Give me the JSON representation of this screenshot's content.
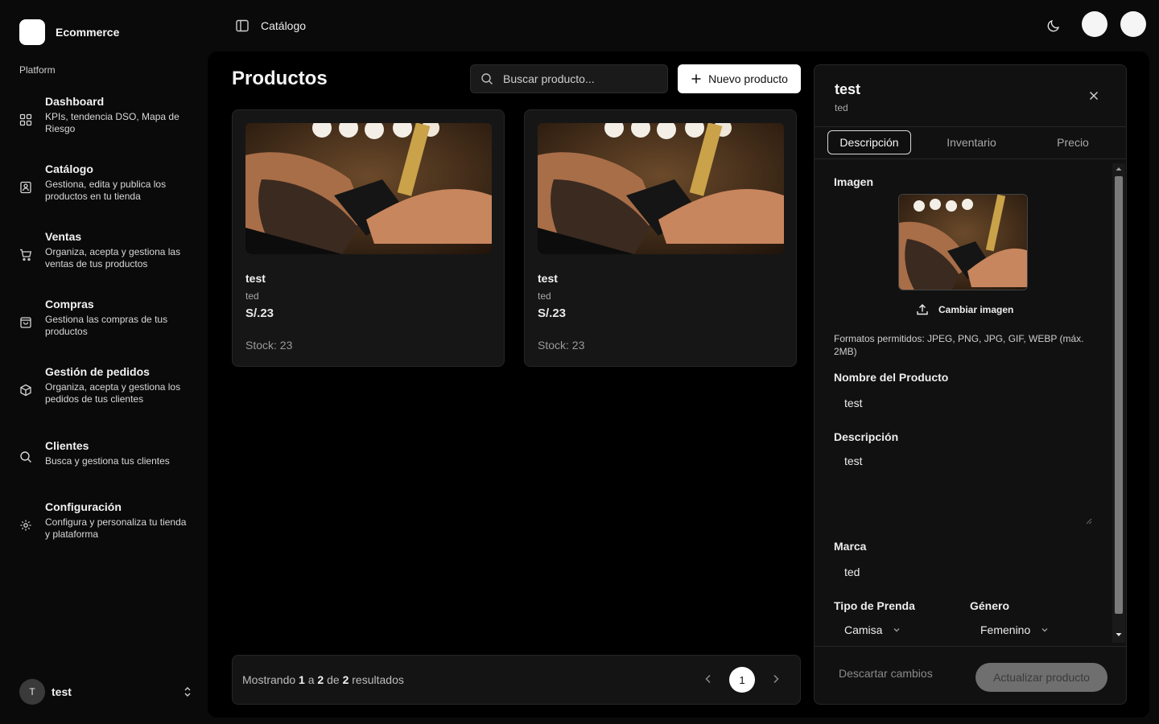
{
  "brand": {
    "name": "Ecommerce"
  },
  "sidebar": {
    "section_label": "Platform",
    "items": [
      {
        "title": "Dashboard",
        "desc": "KPIs, tendencia DSO, Mapa de Riesgo",
        "icon": "layout-grid-icon"
      },
      {
        "title": "Catálogo",
        "desc": "Gestiona, edita y publica los productos en tu tienda",
        "icon": "image-icon"
      },
      {
        "title": "Ventas",
        "desc": "Organiza, acepta y gestiona las ventas de tus productos",
        "icon": "cart-icon"
      },
      {
        "title": "Compras",
        "desc": "Gestiona las compras de tus productos",
        "icon": "shopping-bag-icon"
      },
      {
        "title": "Gestión de pedidos",
        "desc": "Organiza, acepta y gestiona los pedidos de tus clientes",
        "icon": "package-icon"
      },
      {
        "title": "Clientes",
        "desc": "Busca y gestiona tus clientes",
        "icon": "search-icon"
      },
      {
        "title": "Configuración",
        "desc": "Configura y personaliza tu tienda y plataforma",
        "icon": "gear-icon"
      }
    ],
    "user": {
      "initial": "T",
      "name": "test"
    }
  },
  "header": {
    "breadcrumb": "Catálogo"
  },
  "main": {
    "title": "Productos",
    "search_placeholder": "Buscar producto...",
    "new_button": "Nuevo producto",
    "products": [
      {
        "name": "test",
        "brand": "ted",
        "price": "S/.23",
        "stock": "Stock: 23"
      },
      {
        "name": "test",
        "brand": "ted",
        "price": "S/.23",
        "stock": "Stock: 23"
      }
    ],
    "pagination": {
      "prefix": "Mostrando",
      "from": "1",
      "to_word": "a",
      "to": "2",
      "of_word": "de",
      "total": "2",
      "suffix": "resultados",
      "current_page": "1"
    }
  },
  "panel": {
    "title": "test",
    "subtitle": "ted",
    "tabs": [
      "Descripción",
      "Inventario",
      "Precio"
    ],
    "image_label": "Imagen",
    "change_image": "Cambiar imagen",
    "formats": "Formatos permitidos: JPEG, PNG, JPG, GIF, WEBP (máx. 2MB)",
    "name_label": "Nombre del Producto",
    "name_value": "test",
    "desc_label": "Descripción",
    "desc_value": "test",
    "brand_label": "Marca",
    "brand_value": "ted",
    "garment_label": "Tipo de Prenda",
    "garment_value": "Camisa",
    "gender_label": "Género",
    "gender_value": "Femenino",
    "discard": "Descartar cambios",
    "update": "Actualizar producto"
  }
}
